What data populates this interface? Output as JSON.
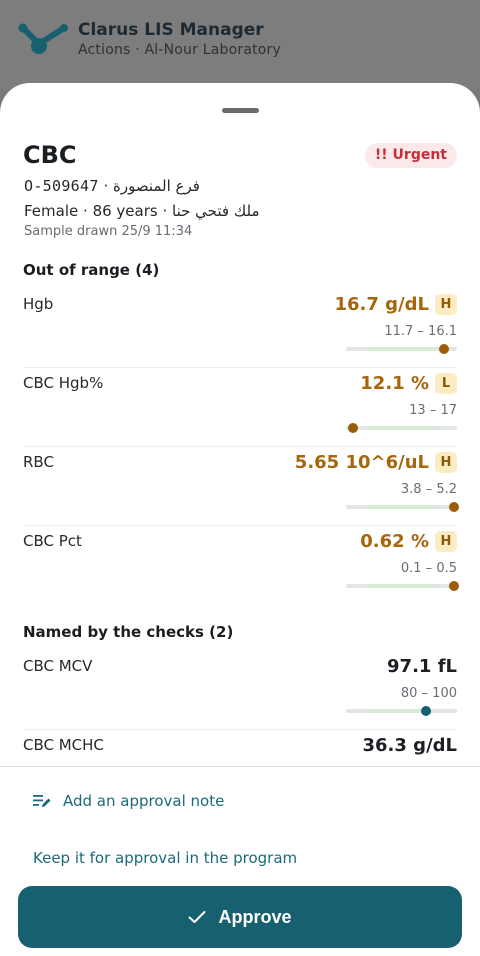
{
  "app": {
    "title": "Clarus LIS Manager",
    "subtitle": "Actions · Al-Nour Laboratory"
  },
  "order": {
    "test_name": "CBC",
    "urgency_label": "!! Urgent",
    "order_id": "O-509647",
    "branch": "فرع المنصورة",
    "sex": "Female",
    "age": "86 years",
    "patient_name": "ملك فتحي حنا",
    "sample_drawn": "Sample drawn 25/9 11:34"
  },
  "sections": {
    "out_of_range_title": "Out of range (4)",
    "named_title": "Named by the checks (2)"
  },
  "out_of_range": [
    {
      "name": "Hgb",
      "value": "16.7 g/dL",
      "flag": "H",
      "range": "11.7 – 16.1",
      "position": 0.88
    },
    {
      "name": "CBC Hgb%",
      "value": "12.1 %",
      "flag": "L",
      "range": "13 – 17",
      "position": 0.06
    },
    {
      "name": "RBC",
      "value": "5.65 10^6/uL",
      "flag": "H",
      "range": "3.8 – 5.2",
      "position": 0.97
    },
    {
      "name": "CBC Pct",
      "value": "0.62 %",
      "flag": "H",
      "range": "0.1 – 0.5",
      "position": 0.97
    }
  ],
  "named_by_checks": [
    {
      "name": "CBC MCV",
      "value": "97.1 fL",
      "flag": "",
      "range": "80 – 100",
      "position": 0.72
    },
    {
      "name": "CBC MCHC",
      "value": "36.3 g/dL",
      "flag": "",
      "range": "",
      "position": null
    }
  ],
  "actions": {
    "add_note": "Add an approval note",
    "keep_for_program": "Keep it for approval in the program",
    "approve": "Approve"
  },
  "colors": {
    "accent": "#17606f",
    "abnormal": "#a8660c",
    "urgent": "#c62f37"
  }
}
